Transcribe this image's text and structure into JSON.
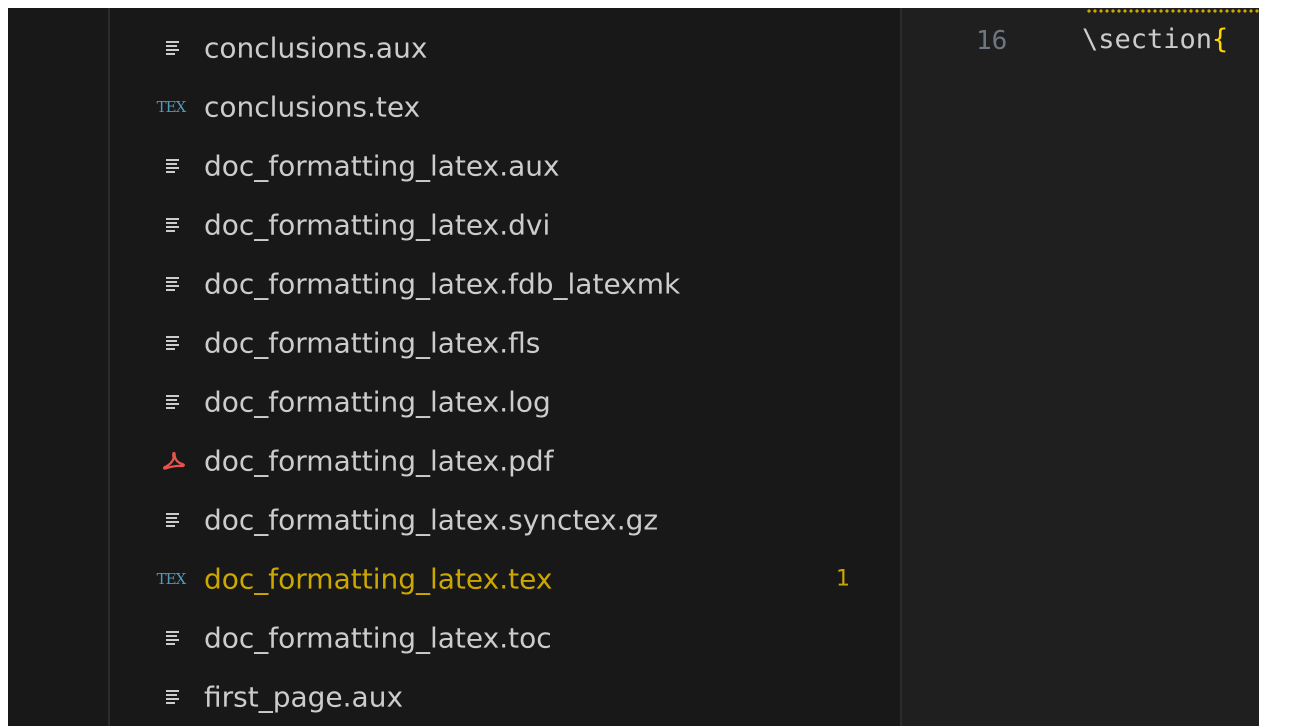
{
  "theme": {
    "sidebar_bg": "#181818",
    "editor_bg": "#1f1f1f",
    "text": "#cccccc",
    "modified": "#cca700",
    "tex_icon": "#519aba",
    "pdf_icon": "#e5534b",
    "line_number": "#6e7681"
  },
  "explorer": {
    "files": [
      {
        "name": "conclusions.aux",
        "icon": "text-file-icon"
      },
      {
        "name": "conclusions.tex",
        "icon": "tex-file-icon",
        "icon_text": "TEX"
      },
      {
        "name": "doc_formatting_latex.aux",
        "icon": "text-file-icon"
      },
      {
        "name": "doc_formatting_latex.dvi",
        "icon": "text-file-icon"
      },
      {
        "name": "doc_formatting_latex.fdb_latexmk",
        "icon": "text-file-icon"
      },
      {
        "name": "doc_formatting_latex.fls",
        "icon": "text-file-icon"
      },
      {
        "name": "doc_formatting_latex.log",
        "icon": "text-file-icon"
      },
      {
        "name": "doc_formatting_latex.pdf",
        "icon": "pdf-file-icon"
      },
      {
        "name": "doc_formatting_latex.synctex.gz",
        "icon": "text-file-icon"
      },
      {
        "name": "doc_formatting_latex.tex",
        "icon": "tex-file-icon",
        "icon_text": "TEX",
        "modified": true,
        "badge": "1"
      },
      {
        "name": "doc_formatting_latex.toc",
        "icon": "text-file-icon"
      },
      {
        "name": "first_page.aux",
        "icon": "text-file-icon"
      }
    ]
  },
  "editor": {
    "line_number": "16",
    "code": "\\section",
    "brace": "{"
  }
}
